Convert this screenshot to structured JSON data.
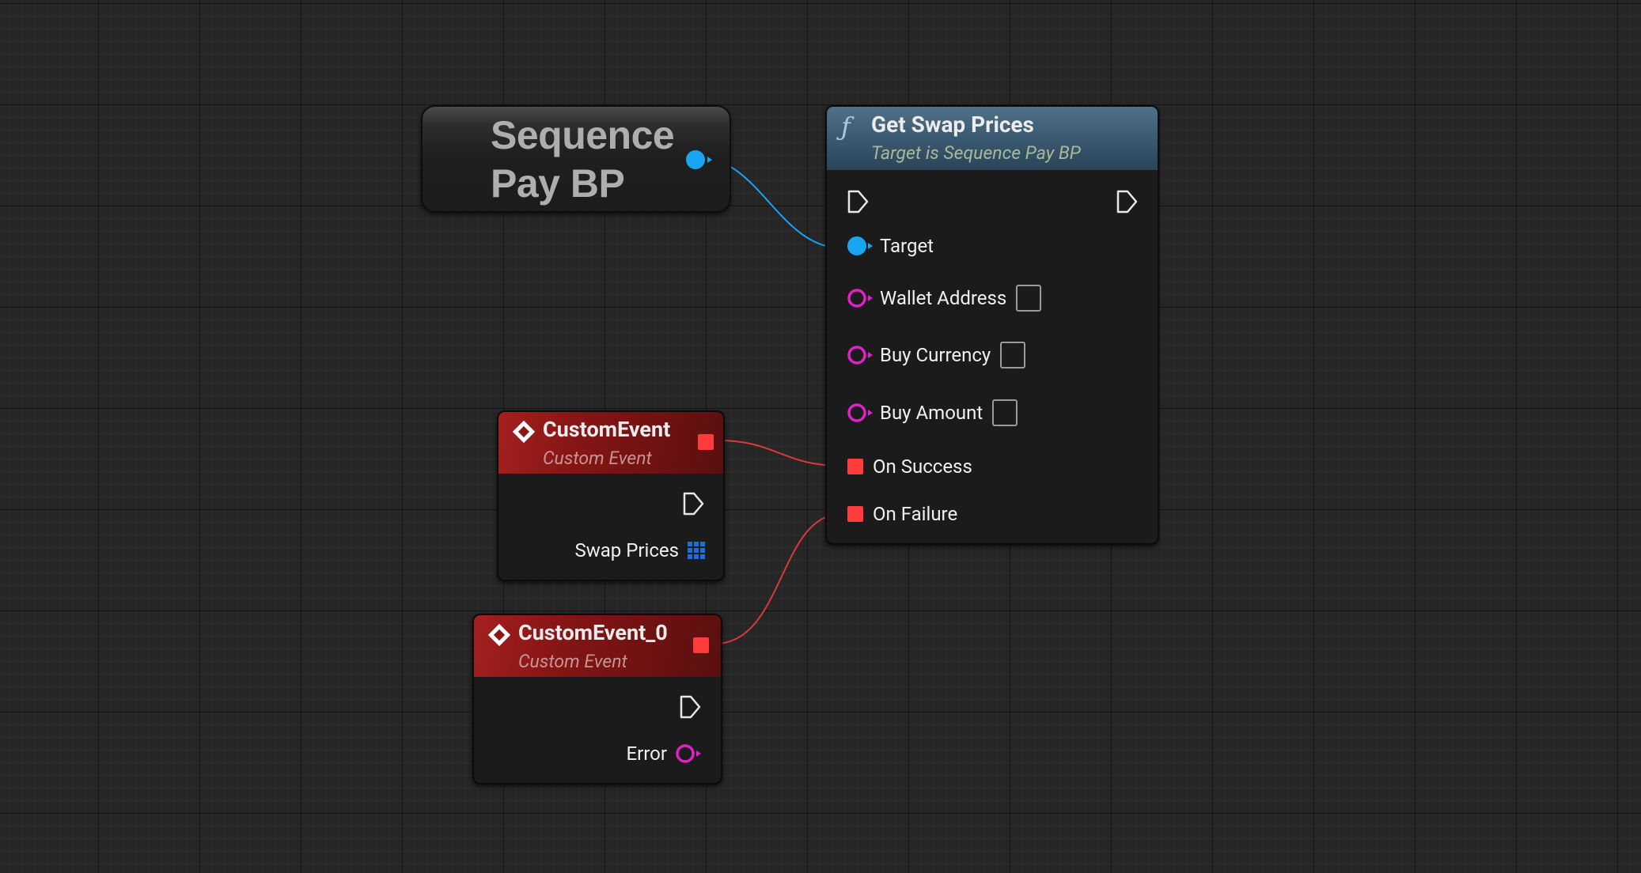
{
  "variable_node": {
    "title_line1": "Sequence",
    "title_line2": "Pay BP"
  },
  "function_node": {
    "icon": "function-icon",
    "title": "Get Swap Prices",
    "subtitle": "Target is Sequence Pay BP",
    "pins": {
      "target": "Target",
      "wallet_address": "Wallet Address",
      "buy_currency": "Buy Currency",
      "buy_amount": "Buy Amount",
      "on_success": "On Success",
      "on_failure": "On Failure"
    }
  },
  "event_node_1": {
    "title": "CustomEvent",
    "subtitle": "Custom Event",
    "output_label": "Swap Prices"
  },
  "event_node_2": {
    "title": "CustomEvent_0",
    "subtitle": "Custom Event",
    "output_label": "Error"
  },
  "colors": {
    "object_pin": "#1aa5f0",
    "string_pin": "#e020c8",
    "delegate_pin": "#ff3b3b",
    "array_pin": "#1a6fe0",
    "function_header": "#3d5c73",
    "event_header": "#861515"
  }
}
